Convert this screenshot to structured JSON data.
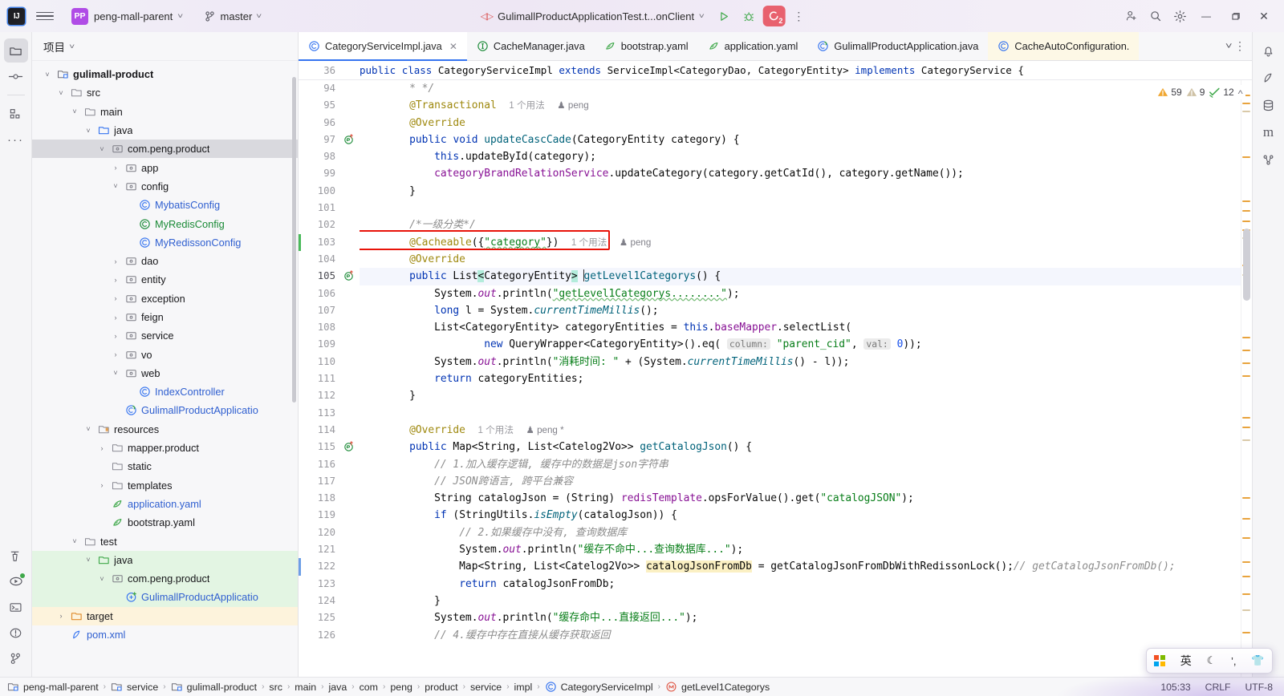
{
  "titlebar": {
    "logo": "IJ",
    "hamburger_icon": "hamburger-icon",
    "project_badge": "PP",
    "project_name": "peng-mall-parent",
    "branch_icon": "git-branch-icon",
    "branch_name": "master",
    "run_config": "GulimallProductApplicationTest.t...onClient",
    "run_icon": "run-icon",
    "debug_icon": "debug-icon",
    "services_badge": "2",
    "more_icon": "more-vertical-icon",
    "share_icon": "add-user-icon",
    "search_icon": "search-icon",
    "settings_icon": "gear-icon",
    "minimize": "—",
    "maximize": "❑",
    "close": "✕"
  },
  "left_rail": {
    "items": [
      {
        "name": "project",
        "icon": "folder-icon",
        "active": true
      },
      {
        "name": "commit",
        "icon": "commit-icon",
        "active": false
      },
      {
        "name": "structure",
        "icon": "structure-icon",
        "active": false
      },
      {
        "name": "more-tool-windows",
        "icon": "ellipsis-icon",
        "active": false
      }
    ],
    "bottom_items": [
      {
        "name": "build",
        "icon": "hammer-icon"
      },
      {
        "name": "run",
        "icon": "run-window-icon"
      },
      {
        "name": "terminal",
        "icon": "terminal-icon"
      },
      {
        "name": "problems",
        "icon": "warning-circle-icon"
      },
      {
        "name": "version-control",
        "icon": "git-branch-icon"
      }
    ]
  },
  "right_rail": {
    "items": [
      {
        "name": "notifications",
        "icon": "bell-icon"
      },
      {
        "name": "maven",
        "icon": "maven-icon"
      },
      {
        "name": "database",
        "icon": "database-icon"
      },
      {
        "name": "ai-assistant",
        "icon": "m-icon"
      },
      {
        "name": "bean-validation",
        "icon": "beans-icon"
      }
    ]
  },
  "project_panel": {
    "title": "项目",
    "chevron": "chevron-down-icon",
    "tree": [
      {
        "label": "gulimall-product",
        "depth": 2,
        "arrow": "down",
        "icon": "module-icon",
        "style": "bold"
      },
      {
        "label": "src",
        "depth": 3,
        "arrow": "down",
        "icon": "folder-icon",
        "style": "plain"
      },
      {
        "label": "main",
        "depth": 4,
        "arrow": "down",
        "icon": "folder-icon",
        "style": "plain"
      },
      {
        "label": "java",
        "depth": 5,
        "arrow": "down",
        "icon": "source-root-icon",
        "style": "plain"
      },
      {
        "label": "com.peng.product",
        "depth": 6,
        "arrow": "down",
        "icon": "package-icon",
        "style": "plain",
        "state": "selected"
      },
      {
        "label": "app",
        "depth": 7,
        "arrow": "right",
        "icon": "package-icon",
        "style": "plain"
      },
      {
        "label": "config",
        "depth": 7,
        "arrow": "down",
        "icon": "package-icon",
        "style": "plain"
      },
      {
        "label": "MybatisConfig",
        "depth": 8,
        "arrow": "none",
        "icon": "class-icon",
        "style": "blue"
      },
      {
        "label": "MyRedisConfig",
        "depth": 8,
        "arrow": "none",
        "icon": "class-icon-green",
        "style": "green"
      },
      {
        "label": "MyRedissonConfig",
        "depth": 8,
        "arrow": "none",
        "icon": "class-icon",
        "style": "blue"
      },
      {
        "label": "dao",
        "depth": 7,
        "arrow": "right",
        "icon": "package-icon",
        "style": "plain"
      },
      {
        "label": "entity",
        "depth": 7,
        "arrow": "right",
        "icon": "package-icon",
        "style": "plain"
      },
      {
        "label": "exception",
        "depth": 7,
        "arrow": "right",
        "icon": "package-icon",
        "style": "plain"
      },
      {
        "label": "feign",
        "depth": 7,
        "arrow": "right",
        "icon": "package-icon",
        "style": "plain"
      },
      {
        "label": "service",
        "depth": 7,
        "arrow": "right",
        "icon": "package-icon",
        "style": "plain"
      },
      {
        "label": "vo",
        "depth": 7,
        "arrow": "right",
        "icon": "package-icon",
        "style": "plain"
      },
      {
        "label": "web",
        "depth": 7,
        "arrow": "down",
        "icon": "package-icon",
        "style": "plain"
      },
      {
        "label": "IndexController",
        "depth": 8,
        "arrow": "none",
        "icon": "class-icon",
        "style": "blue"
      },
      {
        "label": "GulimallProductApplicatio",
        "depth": 7,
        "arrow": "none",
        "icon": "spring-class-icon",
        "style": "blue"
      },
      {
        "label": "resources",
        "depth": 5,
        "arrow": "down",
        "icon": "resource-root-icon",
        "style": "plain"
      },
      {
        "label": "mapper.product",
        "depth": 6,
        "arrow": "right",
        "icon": "folder-icon",
        "style": "plain"
      },
      {
        "label": "static",
        "depth": 6,
        "arrow": "none",
        "icon": "folder-icon",
        "style": "plain"
      },
      {
        "label": "templates",
        "depth": 6,
        "arrow": "right",
        "icon": "folder-icon",
        "style": "plain"
      },
      {
        "label": "application.yaml",
        "depth": 6,
        "arrow": "none",
        "icon": "yaml-icon",
        "style": "blue"
      },
      {
        "label": "bootstrap.yaml",
        "depth": 6,
        "arrow": "none",
        "icon": "yaml-icon",
        "style": "plain"
      },
      {
        "label": "test",
        "depth": 4,
        "arrow": "down",
        "icon": "folder-icon",
        "style": "plain"
      },
      {
        "label": "java",
        "depth": 5,
        "arrow": "down",
        "icon": "test-root-icon",
        "style": "plain",
        "state": "testroot"
      },
      {
        "label": "com.peng.product",
        "depth": 6,
        "arrow": "down",
        "icon": "package-icon",
        "style": "plain",
        "state": "testroot"
      },
      {
        "label": "GulimallProductApplicatio",
        "depth": 7,
        "arrow": "none",
        "icon": "test-class-icon",
        "style": "blue",
        "state": "testroot"
      },
      {
        "label": "target",
        "depth": 3,
        "arrow": "right",
        "icon": "excluded-folder-icon",
        "style": "plain",
        "state": "excluded"
      },
      {
        "label": "pom.xml",
        "depth": 3,
        "arrow": "none",
        "icon": "maven-icon",
        "style": "blue"
      }
    ]
  },
  "tabs": [
    {
      "label": "CategoryServiceImpl.java",
      "icon": "java-class-icon",
      "active": true,
      "closable": true
    },
    {
      "label": "CacheManager.java",
      "icon": "java-interface-icon",
      "active": false
    },
    {
      "label": "bootstrap.yaml",
      "icon": "yaml-icon",
      "active": false
    },
    {
      "label": "application.yaml",
      "icon": "yaml-icon",
      "active": false
    },
    {
      "label": "GulimallProductApplication.java",
      "icon": "spring-class-icon",
      "active": false
    },
    {
      "label": "CacheAutoConfiguration.",
      "icon": "java-class-icon",
      "active": false,
      "pinned": true
    }
  ],
  "tabs_right": {
    "chevron": "chevron-down-icon",
    "more": "more-vertical-icon"
  },
  "inspection_widget": {
    "warnings": "59",
    "weak_warnings": "9",
    "checks": "12",
    "collapse": "chevron-up-icon"
  },
  "sticky_header": {
    "line_no": "36",
    "text": "public class CategoryServiceImpl extends ServiceImpl<CategoryDao, CategoryEntity> implements CategoryService {"
  },
  "editor": {
    "first_line": 94,
    "current_line": 105,
    "lines": [
      {
        "n": "94",
        "html": "        <span class='cmt'>* */</span>"
      },
      {
        "n": "95",
        "html": "        <span class='anno'>@Transactional</span>  <span class='codevision'>1 个用法</span>  <span class='codevision cv-user'>&#9823; peng</span>"
      },
      {
        "n": "96",
        "html": "        <span class='anno'>@Override</span>"
      },
      {
        "n": "97",
        "html": "        <span class='kw'>public</span> <span class='kw'>void</span> <span class='mth'>updateCascCade</span>(CategoryEntity category) {",
        "icon": "override-method-icon"
      },
      {
        "n": "98",
        "html": "            <span class='kw'>this</span>.updateById(category);"
      },
      {
        "n": "99",
        "html": "            <span class='fld'>categoryBrandRelationService</span>.updateCategory(category.getCatId(), category.getName());"
      },
      {
        "n": "100",
        "html": "        }"
      },
      {
        "n": "101",
        "html": ""
      },
      {
        "n": "102",
        "html": "        <span class='cmt'>/*一级分类*/</span>"
      },
      {
        "n": "103",
        "html": "        <span class='anno'>@Cacheable</span>({<span class='str spell'>\"category\"</span>})  <span class='codevision'>1 个用法</span>  <span class='codevision cv-user'>&#9823; peng</span>",
        "vcs": "green"
      },
      {
        "n": "104",
        "html": "        <span class='anno'>@Override</span>"
      },
      {
        "n": "105",
        "html": "        <span class='kw'>public</span> List<span class='angle-hl'>&lt;</span>CategoryEntity<span class='angle-hl'>&gt;</span> <span class='caret'></span><span class='mth'>getLevel1Categorys</span>() {",
        "icon": "override-method-icon",
        "current": true
      },
      {
        "n": "106",
        "html": "            System.<span class='fld'><i>out</i></span>.println(<span class='str spell'>\"getLevel1Categorys........\"</span>);"
      },
      {
        "n": "107",
        "html": "            <span class='kw'>long</span> l = System.<span class='mth'><i>currentTimeMillis</i></span>();"
      },
      {
        "n": "108",
        "html": "            List&lt;CategoryEntity&gt; categoryEntities = <span class='kw'>this</span>.<span class='fld'>baseMapper</span>.selectList("
      },
      {
        "n": "109",
        "html": "                    <span class='kw'>new</span> QueryWrapper&lt;CategoryEntity&gt;().eq( <span class='hintchip'>column:</span> <span class='str'>\"parent_cid\"</span>, <span class='hintchip'>val:</span> <span class='num'>0</span>));"
      },
      {
        "n": "110",
        "html": "            System.<span class='fld'><i>out</i></span>.println(<span class='str'>\"消耗时间: \"</span> + (System.<span class='mth'><i>currentTimeMillis</i></span>() - l));"
      },
      {
        "n": "111",
        "html": "            <span class='kw'>return</span> categoryEntities;"
      },
      {
        "n": "112",
        "html": "        }"
      },
      {
        "n": "113",
        "html": ""
      },
      {
        "n": "114",
        "html": "        <span class='anno'>@Override</span>  <span class='codevision'>1 个用法</span>  <span class='codevision cv-user'>&#9823; peng *</span>"
      },
      {
        "n": "115",
        "html": "        <span class='kw'>public</span> Map&lt;String, List&lt;Catelog2Vo&gt;&gt; <span class='mth'>getCatalogJson</span>() {",
        "icon": "override-method-icon"
      },
      {
        "n": "116",
        "html": "            <span class='cmt'>// 1.加入缓存逻辑, 缓存中的数据是json字符串</span>"
      },
      {
        "n": "117",
        "html": "            <span class='cmt'>// JSON跨语言, 跨平台兼容</span>"
      },
      {
        "n": "118",
        "html": "            String catalogJson = (String) <span class='fld'>redisTemplate</span>.opsForValue().get(<span class='str'>\"catalogJSON\"</span>);"
      },
      {
        "n": "119",
        "html": "            <span class='kw'>if</span> (StringUtils.<span class='mth'><i>isEmpty</i></span>(catalogJson)) {"
      },
      {
        "n": "120",
        "html": "                <span class='cmt'>// 2.如果缓存中没有, 查询数据库</span>"
      },
      {
        "n": "121",
        "html": "                System.<span class='fld'><i>out</i></span>.println(<span class='str'>\"缓存不命中...查询数据库...\"</span>);"
      },
      {
        "n": "122",
        "html": "                Map&lt;String, List&lt;Catelog2Vo&gt;&gt; <span class='ident-hl'>catalogJsonFromDb</span> = getCatalogJsonFromDbWithRedissonLock();<span class='cmt'>// getCatalogJsonFromDb();</span>",
        "vcs": "blue"
      },
      {
        "n": "123",
        "html": "                <span class='kw'>return</span> catalogJsonFromDb;"
      },
      {
        "n": "124",
        "html": "            }"
      },
      {
        "n": "125",
        "html": "            System.<span class='fld'><i>out</i></span>.println(<span class='str'>\"缓存命中...直接返回...\"</span>);"
      },
      {
        "n": "126",
        "html": "            <span class='cmt'>// 4.缓存中存在直接从缓存获取返回</span>"
      }
    ],
    "annotation_box": {
      "name": "red-highlight-box",
      "target_line": "103",
      "target_text": "@Cacheable({\"category\"})"
    }
  },
  "breadcrumb": {
    "items": [
      {
        "label": "peng-mall-parent",
        "icon": "module-icon"
      },
      {
        "label": "service",
        "icon": "module-icon"
      },
      {
        "label": "gulimall-product",
        "icon": "module-icon"
      },
      {
        "label": "src",
        "icon": "none"
      },
      {
        "label": "main",
        "icon": "none"
      },
      {
        "label": "java",
        "icon": "none"
      },
      {
        "label": "com",
        "icon": "none"
      },
      {
        "label": "peng",
        "icon": "none"
      },
      {
        "label": "product",
        "icon": "none"
      },
      {
        "label": "service",
        "icon": "none"
      },
      {
        "label": "impl",
        "icon": "none"
      },
      {
        "label": "CategoryServiceImpl",
        "icon": "class-icon"
      },
      {
        "label": "getLevel1Categorys",
        "icon": "method-icon"
      }
    ],
    "separator": "›"
  },
  "status_bar": {
    "caret_position": "105:33",
    "line_separator": "CRLF",
    "encoding": "UTF-8"
  },
  "ime_widget": {
    "logo": "windows-logo-icon",
    "mode": "英",
    "moon": "moon-icon",
    "punct": "punctuation-icon",
    "skin": "shirt-icon"
  },
  "colors": {
    "accent": "#3574f0",
    "keyword": "#0033b3",
    "string": "#067d17",
    "annotation": "#9e880d",
    "comment": "#8c8c8c",
    "field": "#871094",
    "method": "#00627a",
    "highlight_box": "#e81309",
    "badge_red": "#e8616e",
    "project_badge": "#b04ce6"
  }
}
